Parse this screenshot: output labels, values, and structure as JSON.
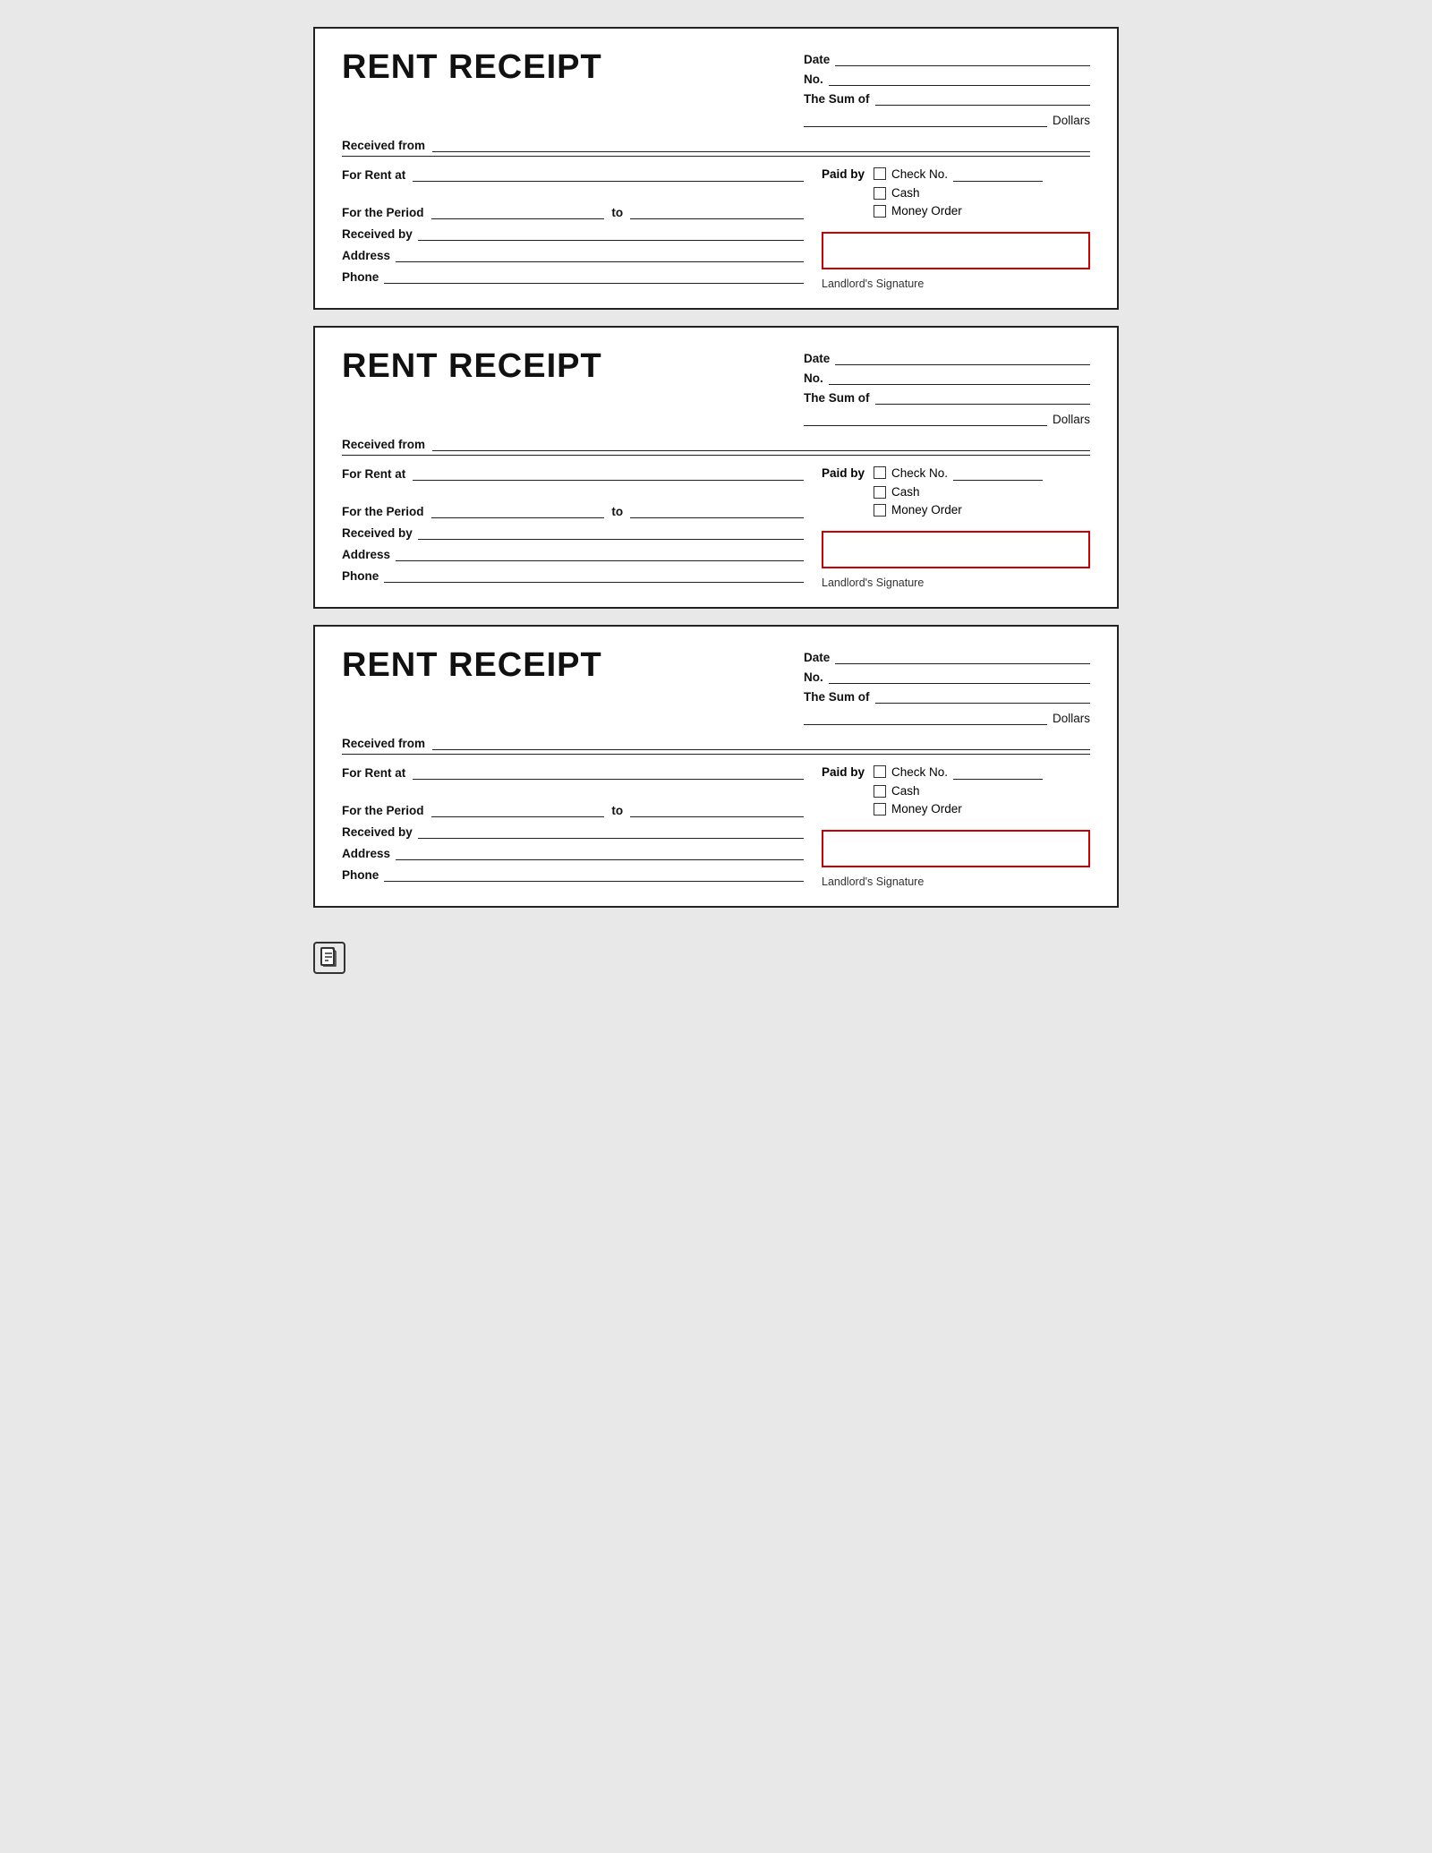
{
  "receipts": [
    {
      "id": "receipt-1",
      "title": "RENT RECEIPT",
      "date_label": "Date",
      "no_label": "No.",
      "sum_label": "The Sum of",
      "dollars_label": "Dollars",
      "received_from_label": "Received from",
      "for_rent_label": "For Rent at",
      "period_label": "For the Period",
      "to_label": "to",
      "received_by_label": "Received by",
      "address_label": "Address",
      "phone_label": "Phone",
      "paid_by_label": "Paid by",
      "check_no_label": "Check No.",
      "cash_label": "Cash",
      "money_order_label": "Money Order",
      "signature_label": "Landlord's Signature"
    },
    {
      "id": "receipt-2",
      "title": "RENT RECEIPT",
      "date_label": "Date",
      "no_label": "No.",
      "sum_label": "The Sum of",
      "dollars_label": "Dollars",
      "received_from_label": "Received from",
      "for_rent_label": "For Rent at",
      "period_label": "For the Period",
      "to_label": "to",
      "received_by_label": "Received by",
      "address_label": "Address",
      "phone_label": "Phone",
      "paid_by_label": "Paid by",
      "check_no_label": "Check No.",
      "cash_label": "Cash",
      "money_order_label": "Money Order",
      "signature_label": "Landlord's Signature"
    },
    {
      "id": "receipt-3",
      "title": "RENT RECEIPT",
      "date_label": "Date",
      "no_label": "No.",
      "sum_label": "The Sum of",
      "dollars_label": "Dollars",
      "received_from_label": "Received from",
      "for_rent_label": "For Rent at",
      "period_label": "For the Period",
      "to_label": "to",
      "received_by_label": "Received by",
      "address_label": "Address",
      "phone_label": "Phone",
      "paid_by_label": "Paid by",
      "check_no_label": "Check No.",
      "cash_label": "Cash",
      "money_order_label": "Money Order",
      "signature_label": "Landlord's Signature"
    }
  ],
  "footer": {
    "icon": "📄"
  }
}
